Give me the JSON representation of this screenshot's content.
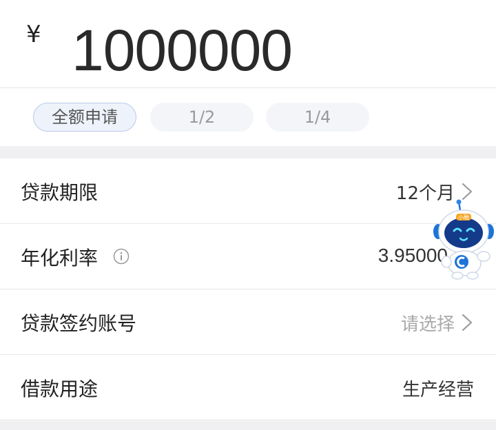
{
  "amount": {
    "currency_symbol": "¥",
    "value": "1000000"
  },
  "quick_select": {
    "full": "全额申请",
    "half": "1/2",
    "quarter": "1/4",
    "selected": "全额申请"
  },
  "form": {
    "loan_term": {
      "label": "贷款期限",
      "value": "12个月"
    },
    "annual_rate": {
      "label": "年化利率",
      "value": "3.95000"
    },
    "signing_account": {
      "label": "贷款签约账号",
      "placeholder": "请选择"
    },
    "loan_purpose": {
      "label": "借款用途",
      "value": "生产经营"
    }
  },
  "assistant": {
    "badge_text": "小融"
  },
  "colors": {
    "chip_selected_bg": "#eef3fb",
    "chip_selected_border": "#b9c9e6",
    "mascot_blue": "#1e73d8"
  }
}
